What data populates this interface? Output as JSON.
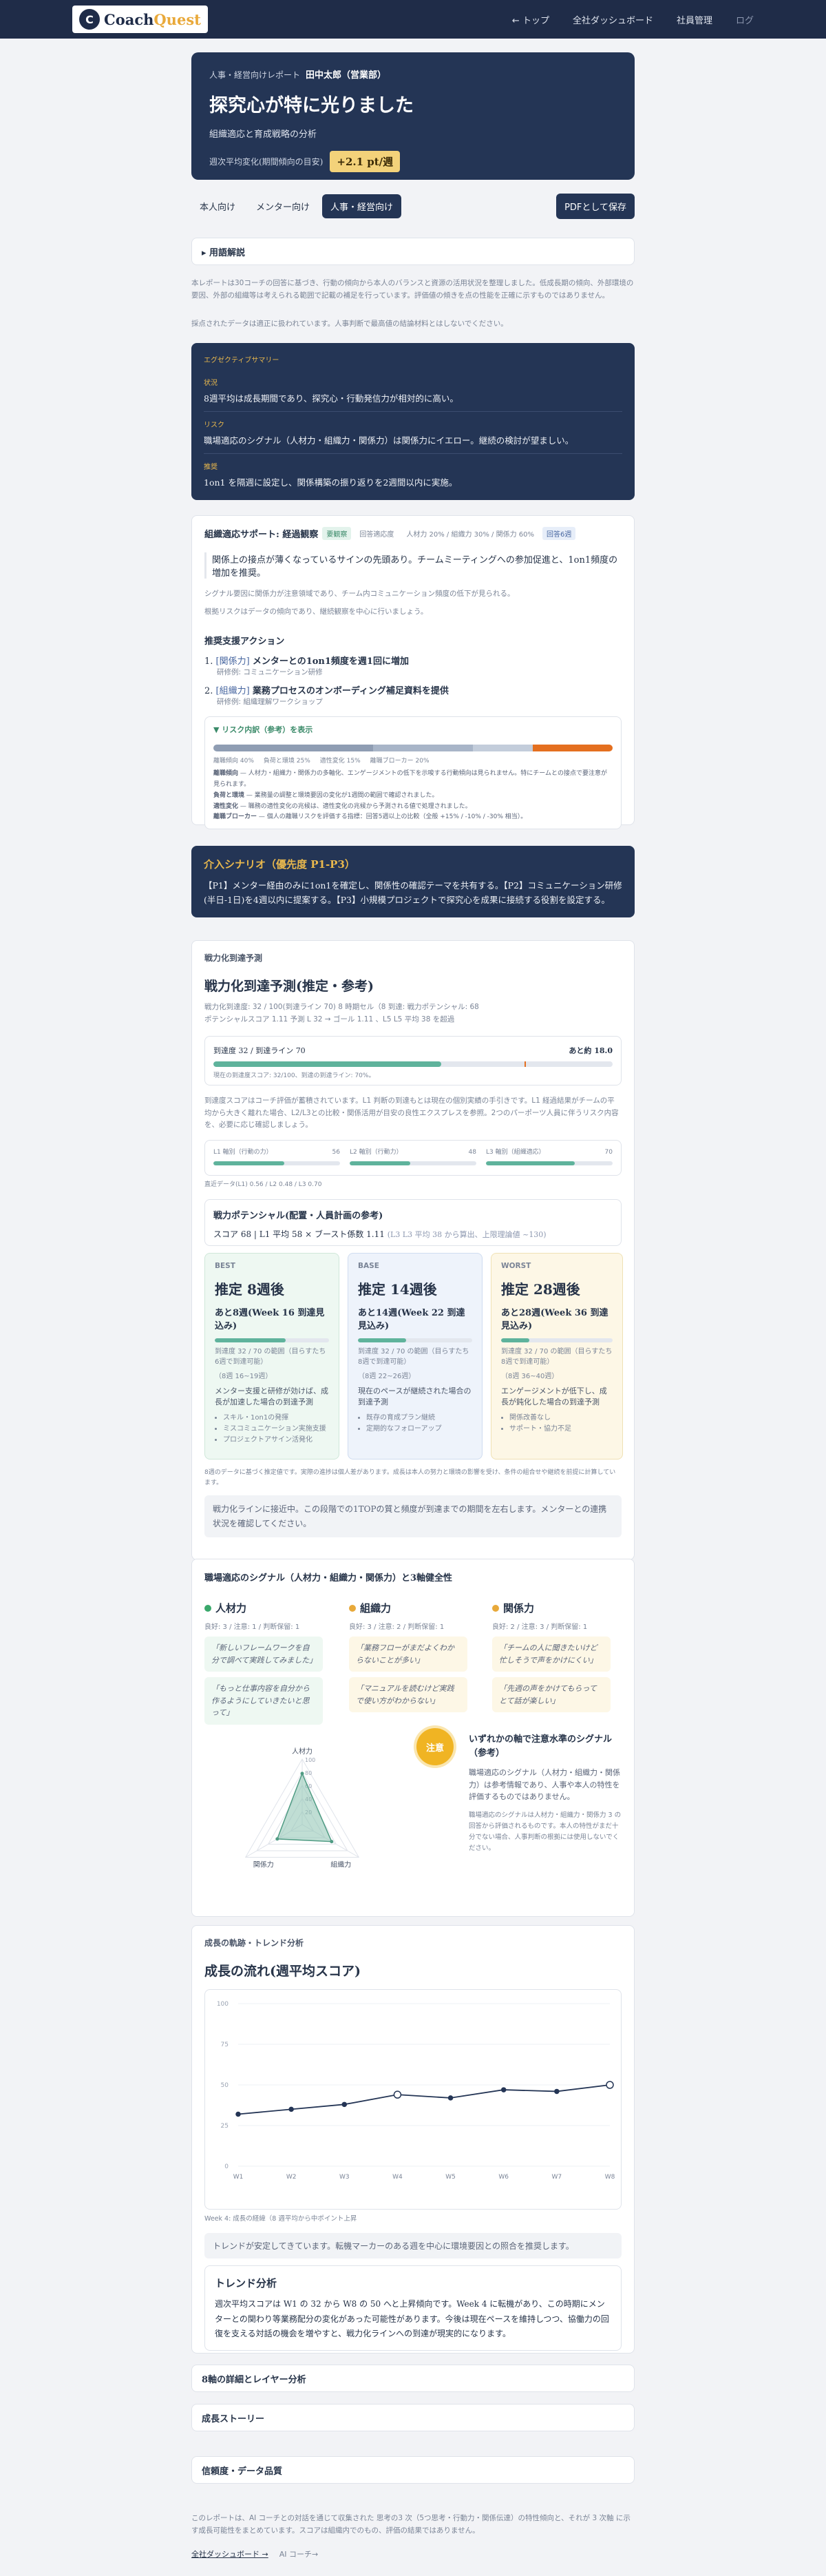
{
  "nav": {
    "logo_letter": "C",
    "logo_main": "Coach",
    "logo_accent": "Quest",
    "links": [
      "← トップ",
      "全社ダッシュボード",
      "社員管理",
      "ログ"
    ]
  },
  "hero": {
    "eyebrow": "人事・経営向けレポート",
    "name": "田中太郎（営業部）",
    "title": "探究心が特に光りました",
    "subtitle": "組織適応と育成戦略の分析",
    "metric_label": "週次平均変化(期間傾向の目安)",
    "metric_value": "+2.1 pt/週"
  },
  "tabs": {
    "items": [
      "本人向け",
      "メンター向け",
      "人事・経営向け"
    ],
    "active": 2,
    "pdf": "PDFとして保存"
  },
  "usage": {
    "label": "▸ 用語解説"
  },
  "intro": {
    "p1": "本レポートは30コーチの回答に基づき、行動の傾向から本人のバランスと資源の活用状況を整理しました。低成長期の傾向、外部環境の要因、外部の組織等は考えられる範囲で記載の補足を行っています。評価値の傾きを点の性能を正確に示すものではありません。",
    "p2": "採点されたデータは適正に扱われています。人事判断で最高値の結論材料とはしないでください。"
  },
  "exec": {
    "heading": "エグゼクティブサマリー",
    "items": [
      {
        "label": "状況",
        "text": "8週平均は成長期間であり、探究心・行動発信力が相対的に高い。"
      },
      {
        "label": "リスク",
        "text": "職場適応のシグナル（人材力・組織力・関係力）は関係力にイエロー。継続の検討が望ましい。"
      },
      {
        "label": "推奨",
        "text": "1on1 を隔週に設定し、関係構築の振り返りを2週間以内に実施。"
      }
    ]
  },
  "support": {
    "title": "組織適応サポート: 経過観察",
    "badge1": "要観察",
    "badge_key": "回答適応度",
    "badge_meta": "人材力 20% / 組織力 30% / 関係力 60%",
    "badge2": "回答6週",
    "highlight": "関係上の接点が薄くなっているサインの先頭あり。チームミーティングへの参加促進と、1on1頻度の増加を推奨。",
    "p1": "シグナル要因に関係力が注意領域であり、チーム内コミュニケーション頻度の低下が見られる。",
    "p2": "根拠リスクはデータの傾向であり、継続観察を中心に行いましょう。",
    "actions_title": "推奨支援アクション",
    "actions": [
      {
        "num": "1.",
        "tag": "[関係力]",
        "text": "メンターとの1on1頻度を週1回に増加",
        "sub": "研修例: コミュニケーション研修"
      },
      {
        "num": "2.",
        "tag": "[組織力]",
        "text": "業務プロセスのオンボーディング補足資料を提供",
        "sub": "研修例: 組織理解ワークショップ"
      }
    ],
    "risk_toggle": "▼ リスク内訳（参考）を表示",
    "risk_legend": [
      "離職傾向 40%",
      "負荷と環境 25%",
      "適性変化 15%",
      "離職ブローカー 20%"
    ],
    "risk_rows": [
      {
        "k": "離職傾向",
        "v": "— 人材力・組織力・関係力の多軸化、エンゲージメントの低下を示唆する行動傾向は見られません。特にチームとの接点で要注意が見られます。"
      },
      {
        "k": "負荷と環境",
        "v": "— 業務量の調整と環境要因の変化が1週間の範囲で確認されました。"
      },
      {
        "k": "適性変化",
        "v": "— 職務の適性変化の兆候は、適性変化の兆候から予測される値で処理されました。"
      },
      {
        "k": "離職ブローカー",
        "v": "— 個人の離職リスクを評価する指標：回答5週以上の比較（全般 +15% / -10% / -30% 相当）。"
      }
    ]
  },
  "scenario": {
    "title": "介入シナリオ（優先度 P1-P3）",
    "text": "【P1】メンター経由のみに1on1を確定し、関係性の確認テーマを共有する。【P2】コミュニケーション研修(半日-1日)を4週以内に提案する。【P3】小規模プロジェクトで探究心を成果に接続する役割を設定する。"
  },
  "forecast": {
    "section": "戦力化到達予測",
    "title": "戦力化到達予測(推定・参考)",
    "meta1": "戦力化到達度: 32 / 100(到達ライン 70) 8 時期セル（8 到達: 戦力ポテンシャル: 68",
    "meta2": "ポテンシャルスコア 1.11 予測 L 32 → ゴール 1.11 、L5 L5 平均 38 を超過",
    "gauge_left": "到達度 32 / 到達ライン 70",
    "gauge_right": "あと約 18.0",
    "gauge_note": "現在の到達度スコア: 32/100、到達の到達ライン: 70%。",
    "explain": "到達度スコアはコーチ評価が蓄積されています。L1 判断の到達もとは現在の個別実績の手引きです。L1 経過結果がチームの平均から大きく離れた場合、L2/L3との比較・関係活用が目安の良性エクスプレスを参照。2つのパーポーツ人員に伴うリスク内容を、必要に応じ確認しましょう。",
    "axes": [
      {
        "label": "L1 軸別（行動の力）",
        "v": "56"
      },
      {
        "label": "L2 軸別（行動力）",
        "v": "48"
      },
      {
        "label": "L3 軸別（組織適応）",
        "v": "70"
      }
    ],
    "axes_fill": [
      0.56,
      0.48,
      0.7
    ],
    "axes_note": "直近データ(L1) 0.56 / L2 0.48 / L3 0.70",
    "potential_title": "戦力ポテンシャル(配置・人員計画の参考)",
    "potential": "スコア 68 | L1 平均 58 × ブースト係数 1.11",
    "potential_dim": "(L3 L3 平均 38 から算出、上限理論値 ~130)",
    "scenarios": [
      {
        "tag": "BEST",
        "est": "推定 8週後",
        "wk": "あと8週(Week 16 到達見込み)",
        "fill": 0.62,
        "info": "到達度 32 / 70 の範囲（目らすたち6週で到達可能）",
        "sub": "（8週 16~19週）",
        "lead": "メンター支援と研修が効けば、成長が加速した場合の到達予測",
        "bullets": [
          "スキル・1on1の発揮",
          "ミスコミュニケーション実施支援",
          "プロジェクトアサイン活発化"
        ]
      },
      {
        "tag": "BASE",
        "est": "推定 14週後",
        "wk": "あと14週(Week 22 到達見込み)",
        "fill": 0.42,
        "info": "到達度 32 / 70 の範囲（目らすたち8週で到達可能）",
        "sub": "（8週 22~26週）",
        "lead": "現在のペースが継続された場合の到達予測",
        "bullets": [
          "既存の育成プラン継続",
          "定期的なフォローアップ"
        ]
      },
      {
        "tag": "WORST",
        "est": "推定 28週後",
        "wk": "あと28週(Week 36 到達見込み)",
        "fill": 0.25,
        "info": "到達度 32 / 70 の範囲（目らすたち8週で到達可能）",
        "sub": "（8週 36~40週）",
        "lead": "エンゲージメントが低下し、成長が鈍化した場合の到達予測",
        "bullets": [
          "関係改善なし",
          "サポート・協力不足"
        ]
      }
    ],
    "footnote": "8週のデータに基づく推定値です。実際の進捗は個人差があります。成長は本人の努力と環境の影響を受け、条件の組合せや継続を前提に計算しています。",
    "callout": "戦力化ラインに接近中。この段階での1TOPの質と頻度が到達までの期間を左右します。メンターとの連携状況を確認してください。"
  },
  "signals": {
    "section": "職場適応のシグナル（人材力・組織力・関係力）と3軸健全性",
    "axes": [
      {
        "name": "人材力",
        "color": "#3aa86b",
        "meta": "良好: 3 / 注意: 1 / 判断保留: 1",
        "q1": "「新しいフレームワークを自分で調べて実践してみました」",
        "q2": "「もっと仕事内容を自分から作るようにしていきたいと思って」"
      },
      {
        "name": "組織力",
        "color": "#e8a93a",
        "meta": "良好: 3 / 注意: 2 / 判断保留: 1",
        "q1": "「業務フローがまだよくわからないことが多い」",
        "q2": "「マニュアルを読むけど実践で使い方がわからない」"
      },
      {
        "name": "関係力",
        "color": "#e8a93a",
        "meta": "良好: 2 / 注意: 3 / 判断保留: 1",
        "q1": "「チームの人に聞きたいけど忙しそうで声をかけにくい」",
        "q2": "「先週の声をかけてもらってとて話が楽しい」"
      }
    ],
    "radar_labels": [
      "人材力",
      "組織力",
      "関係力"
    ],
    "radar_values": [
      0.78,
      0.52,
      0.44
    ],
    "radar_ticks": [
      "100",
      "80",
      "60",
      "40",
      "20"
    ],
    "status": "注意",
    "lens_title": "いずれかの軸で注意水準のシグナル（参考）",
    "lens_p1": "職場適応のシグナル（人材力・組織力・関係力）は参考情報であり、人事や本人の特性を評価するものではありません。",
    "lens_p2": "職場適応のシグナルは人材力・組織力・関係力 3 の回答から評価されるものです。本人の特性がまだ十分でない場合、人事判断の根拠には使用しないでください。"
  },
  "trend": {
    "section": "成長の軌跡・トレンド分析",
    "title": "成長の流れ(週平均スコア)",
    "note": "Week 4: 成長の経緯（8 週平均から中ポイント上昇",
    "callout": "トレンドが安定してきています。転機マーカーのある週を中心に環境要因との照合を推奨します。",
    "analysis_title": "トレンド分析",
    "analysis": "週次平均スコアは W1 の 32 から W8 の 50 へと上昇傾向です。Week 4 に転機があり、この時期にメンターとの関わり等業務配分の変化があった可能性があります。今後は現在ペースを維持しつつ、協働力の回復を支える対話の機会を増やすと、戦力化ラインへの到達が現実的になります。"
  },
  "chart_data": {
    "type": "line",
    "categories": [
      "W1",
      "W2",
      "W3",
      "W4",
      "W5",
      "W6",
      "W7",
      "W8"
    ],
    "values": [
      32,
      35,
      38,
      44,
      42,
      47,
      46,
      50
    ],
    "ylim": [
      0,
      100
    ],
    "yticks": [
      "100",
      "75",
      "50",
      "25",
      "0"
    ],
    "marker_weeks": [
      3,
      7
    ]
  },
  "more": [
    "8軸の詳細とレイヤー分析",
    "成長ストーリー",
    "信頼度・データ品質"
  ],
  "footer": {
    "text": "このレポートは、AI コーチとの対話を通じて収集された 思考の3 次（5つ思考・行動力・関係伝達）の特性傾向と、それが 3 次軸 に示す成長可能性をまとめています。スコアは組織内でのもの、評価の結果ではありません。",
    "links": [
      "全社ダッシュボード →",
      "AI コーチ→"
    ]
  },
  "colors": {
    "navy": "#243555",
    "green": "#5fb39c",
    "orange": "#e46f1f",
    "amber": "#e8a93a"
  }
}
